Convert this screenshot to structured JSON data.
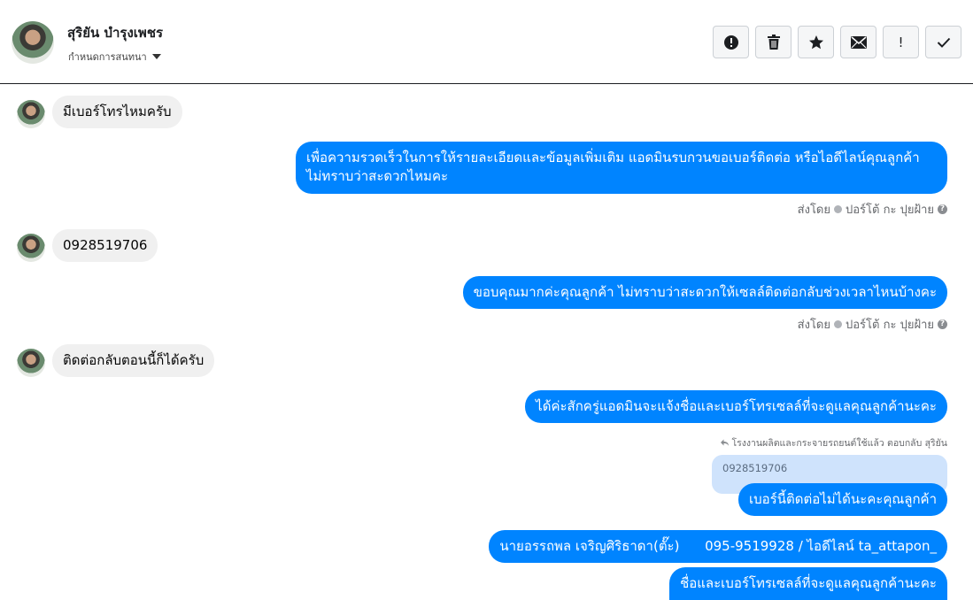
{
  "header": {
    "contact_name": "สุริยัน บำรุงเพชร",
    "assign_label": "กำหนดการสนทนา",
    "actions": [
      {
        "name": "spam",
        "icon": "alert-circle-icon"
      },
      {
        "name": "delete",
        "icon": "trash-icon"
      },
      {
        "name": "star",
        "icon": "star-icon"
      },
      {
        "name": "mark-unread",
        "icon": "envelope-icon",
        "label": "✉"
      },
      {
        "name": "follow-up",
        "icon": "exclamation-icon",
        "label": "!"
      },
      {
        "name": "done",
        "icon": "check-icon",
        "label": "✓"
      }
    ]
  },
  "messages": [
    {
      "direction": "in",
      "text": "มีเบอร์โทรไหมครับ"
    },
    {
      "direction": "out",
      "text": "เพื่อความรวดเร็วในการให้รายละเอียดและข้อมูลเพิ่มเติม แอดมินรบกวนขอเบอร์ติดต่อ หรือไอดีไลน์คุณลูกค้า ไม่ทราบว่าสะดวกไหมคะ"
    },
    {
      "direction": "in",
      "text": "0928519706"
    },
    {
      "direction": "out",
      "text": "ขอบคุณมากค่ะคุณลูกค้า ไม่ทราบว่าสะดวกให้เซลล์ติดต่อกลับช่วงเวลาไหนบ้างคะ"
    },
    {
      "direction": "in",
      "text": "ติดต่อกลับตอนนี้ก็ได้ครับ"
    },
    {
      "direction": "out",
      "text": "ได้ค่ะสักครู่แอดมินจะแจ้งชื่อและเบอร์โทรเซลล์ที่จะดูแลคุณลูกค้านะคะ"
    },
    {
      "direction": "out",
      "text": "เบอร์นี้ติดต่อไม่ได้นะคะคุณลูกค้า"
    },
    {
      "direction": "out",
      "text": "นายอรรถพล เจริญศิริธาดา(ตั๊ะ)      095-9519928 / ไอดีไลน์ ta_attapon_"
    },
    {
      "direction": "out",
      "text": "ชื่อและเบอร์โทรเซลล์ที่จะดูแลคุณลูกค้านะคะ"
    }
  ],
  "sent_by": {
    "prefix": "ส่งโดย",
    "sender": "ปอร์โต้ กะ ปุยฝ้าย",
    "help": "?"
  },
  "reply": {
    "meta": "โรงงานผลิตและกระจายรถยนต์ใช้แล้ว ตอบกลับ สุริยัน",
    "quoted_text": "0928519706"
  },
  "colors": {
    "outgoing_bubble": "#0084ff",
    "incoming_bubble": "#f0f0f0",
    "quoted_bubble": "#cfe3fc"
  }
}
